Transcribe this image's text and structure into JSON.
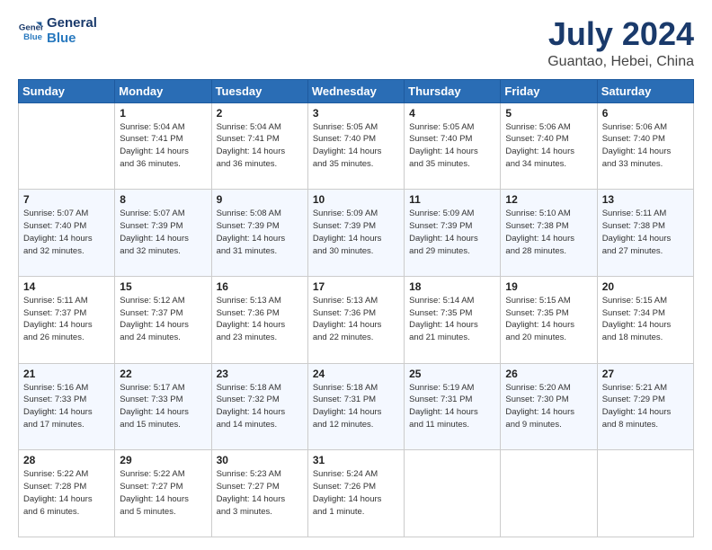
{
  "header": {
    "logo_line1": "General",
    "logo_line2": "Blue",
    "title": "July 2024",
    "subtitle": "Guantao, Hebei, China"
  },
  "columns": [
    "Sunday",
    "Monday",
    "Tuesday",
    "Wednesday",
    "Thursday",
    "Friday",
    "Saturday"
  ],
  "weeks": [
    [
      {
        "day": "",
        "info": ""
      },
      {
        "day": "1",
        "info": "Sunrise: 5:04 AM\nSunset: 7:41 PM\nDaylight: 14 hours\nand 36 minutes."
      },
      {
        "day": "2",
        "info": "Sunrise: 5:04 AM\nSunset: 7:41 PM\nDaylight: 14 hours\nand 36 minutes."
      },
      {
        "day": "3",
        "info": "Sunrise: 5:05 AM\nSunset: 7:40 PM\nDaylight: 14 hours\nand 35 minutes."
      },
      {
        "day": "4",
        "info": "Sunrise: 5:05 AM\nSunset: 7:40 PM\nDaylight: 14 hours\nand 35 minutes."
      },
      {
        "day": "5",
        "info": "Sunrise: 5:06 AM\nSunset: 7:40 PM\nDaylight: 14 hours\nand 34 minutes."
      },
      {
        "day": "6",
        "info": "Sunrise: 5:06 AM\nSunset: 7:40 PM\nDaylight: 14 hours\nand 33 minutes."
      }
    ],
    [
      {
        "day": "7",
        "info": "Sunrise: 5:07 AM\nSunset: 7:40 PM\nDaylight: 14 hours\nand 32 minutes."
      },
      {
        "day": "8",
        "info": "Sunrise: 5:07 AM\nSunset: 7:39 PM\nDaylight: 14 hours\nand 32 minutes."
      },
      {
        "day": "9",
        "info": "Sunrise: 5:08 AM\nSunset: 7:39 PM\nDaylight: 14 hours\nand 31 minutes."
      },
      {
        "day": "10",
        "info": "Sunrise: 5:09 AM\nSunset: 7:39 PM\nDaylight: 14 hours\nand 30 minutes."
      },
      {
        "day": "11",
        "info": "Sunrise: 5:09 AM\nSunset: 7:39 PM\nDaylight: 14 hours\nand 29 minutes."
      },
      {
        "day": "12",
        "info": "Sunrise: 5:10 AM\nSunset: 7:38 PM\nDaylight: 14 hours\nand 28 minutes."
      },
      {
        "day": "13",
        "info": "Sunrise: 5:11 AM\nSunset: 7:38 PM\nDaylight: 14 hours\nand 27 minutes."
      }
    ],
    [
      {
        "day": "14",
        "info": "Sunrise: 5:11 AM\nSunset: 7:37 PM\nDaylight: 14 hours\nand 26 minutes."
      },
      {
        "day": "15",
        "info": "Sunrise: 5:12 AM\nSunset: 7:37 PM\nDaylight: 14 hours\nand 24 minutes."
      },
      {
        "day": "16",
        "info": "Sunrise: 5:13 AM\nSunset: 7:36 PM\nDaylight: 14 hours\nand 23 minutes."
      },
      {
        "day": "17",
        "info": "Sunrise: 5:13 AM\nSunset: 7:36 PM\nDaylight: 14 hours\nand 22 minutes."
      },
      {
        "day": "18",
        "info": "Sunrise: 5:14 AM\nSunset: 7:35 PM\nDaylight: 14 hours\nand 21 minutes."
      },
      {
        "day": "19",
        "info": "Sunrise: 5:15 AM\nSunset: 7:35 PM\nDaylight: 14 hours\nand 20 minutes."
      },
      {
        "day": "20",
        "info": "Sunrise: 5:15 AM\nSunset: 7:34 PM\nDaylight: 14 hours\nand 18 minutes."
      }
    ],
    [
      {
        "day": "21",
        "info": "Sunrise: 5:16 AM\nSunset: 7:33 PM\nDaylight: 14 hours\nand 17 minutes."
      },
      {
        "day": "22",
        "info": "Sunrise: 5:17 AM\nSunset: 7:33 PM\nDaylight: 14 hours\nand 15 minutes."
      },
      {
        "day": "23",
        "info": "Sunrise: 5:18 AM\nSunset: 7:32 PM\nDaylight: 14 hours\nand 14 minutes."
      },
      {
        "day": "24",
        "info": "Sunrise: 5:18 AM\nSunset: 7:31 PM\nDaylight: 14 hours\nand 12 minutes."
      },
      {
        "day": "25",
        "info": "Sunrise: 5:19 AM\nSunset: 7:31 PM\nDaylight: 14 hours\nand 11 minutes."
      },
      {
        "day": "26",
        "info": "Sunrise: 5:20 AM\nSunset: 7:30 PM\nDaylight: 14 hours\nand 9 minutes."
      },
      {
        "day": "27",
        "info": "Sunrise: 5:21 AM\nSunset: 7:29 PM\nDaylight: 14 hours\nand 8 minutes."
      }
    ],
    [
      {
        "day": "28",
        "info": "Sunrise: 5:22 AM\nSunset: 7:28 PM\nDaylight: 14 hours\nand 6 minutes."
      },
      {
        "day": "29",
        "info": "Sunrise: 5:22 AM\nSunset: 7:27 PM\nDaylight: 14 hours\nand 5 minutes."
      },
      {
        "day": "30",
        "info": "Sunrise: 5:23 AM\nSunset: 7:27 PM\nDaylight: 14 hours\nand 3 minutes."
      },
      {
        "day": "31",
        "info": "Sunrise: 5:24 AM\nSunset: 7:26 PM\nDaylight: 14 hours\nand 1 minute."
      },
      {
        "day": "",
        "info": ""
      },
      {
        "day": "",
        "info": ""
      },
      {
        "day": "",
        "info": ""
      }
    ]
  ]
}
